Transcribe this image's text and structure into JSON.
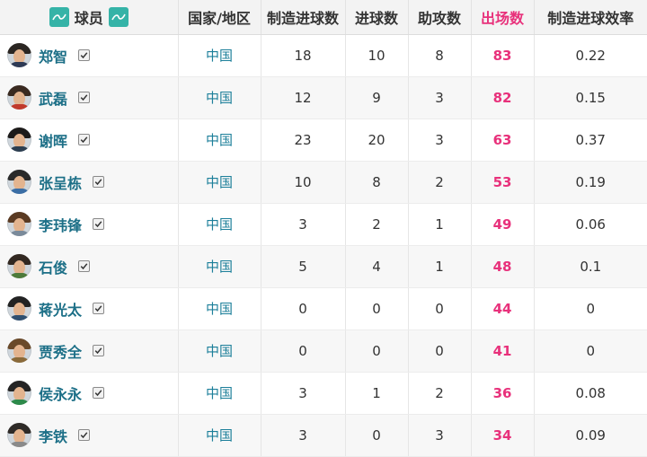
{
  "headers": {
    "player": "球员",
    "country": "国家/地区",
    "created": "制造进球数",
    "goals": "进球数",
    "assists": "助攻数",
    "appearances": "出场数",
    "efficiency": "制造进球效率"
  },
  "accent_color": "#e8317b",
  "link_color": "#1c6f87",
  "logo_color": "#35b3a7",
  "rows": [
    {
      "name": "郑智",
      "country": "中国",
      "created": "18",
      "goals": "10",
      "assists": "8",
      "appearances": "83",
      "efficiency": "0.22"
    },
    {
      "name": "武磊",
      "country": "中国",
      "created": "12",
      "goals": "9",
      "assists": "3",
      "appearances": "82",
      "efficiency": "0.15"
    },
    {
      "name": "谢晖",
      "country": "中国",
      "created": "23",
      "goals": "20",
      "assists": "3",
      "appearances": "63",
      "efficiency": "0.37"
    },
    {
      "name": "张呈栋",
      "country": "中国",
      "created": "10",
      "goals": "8",
      "assists": "2",
      "appearances": "53",
      "efficiency": "0.19"
    },
    {
      "name": "李玮锋",
      "country": "中国",
      "created": "3",
      "goals": "2",
      "assists": "1",
      "appearances": "49",
      "efficiency": "0.06"
    },
    {
      "name": "石俊",
      "country": "中国",
      "created": "5",
      "goals": "4",
      "assists": "1",
      "appearances": "48",
      "efficiency": "0.1"
    },
    {
      "name": "蒋光太",
      "country": "中国",
      "created": "0",
      "goals": "0",
      "assists": "0",
      "appearances": "44",
      "efficiency": "0"
    },
    {
      "name": "贾秀全",
      "country": "中国",
      "created": "0",
      "goals": "0",
      "assists": "0",
      "appearances": "41",
      "efficiency": "0"
    },
    {
      "name": "侯永永",
      "country": "中国",
      "created": "3",
      "goals": "1",
      "assists": "2",
      "appearances": "36",
      "efficiency": "0.08"
    },
    {
      "name": "李铁",
      "country": "中国",
      "created": "3",
      "goals": "0",
      "assists": "3",
      "appearances": "34",
      "efficiency": "0.09"
    }
  ]
}
